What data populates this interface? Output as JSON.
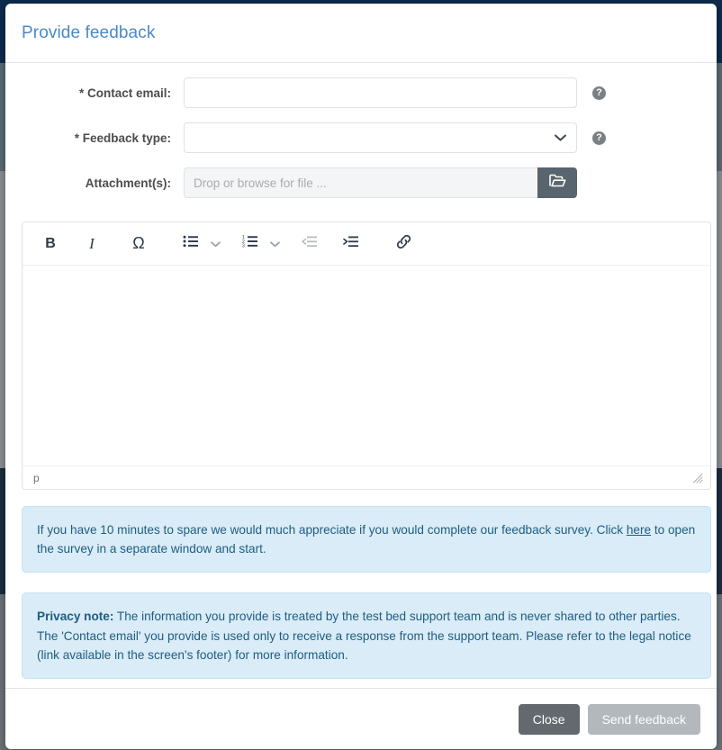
{
  "page": {
    "backdrop_color": "#0e2a47"
  },
  "modal": {
    "title": "Provide feedback",
    "accent_color": "#4a89c8"
  },
  "form": {
    "fields": [
      {
        "label": "* Contact email:",
        "type": "text",
        "value": "",
        "placeholder": "",
        "help_icon": "help-circle-icon",
        "has_help": true
      },
      {
        "label": "* Feedback type:",
        "type": "select",
        "value": "",
        "placeholder": "",
        "help_icon": "help-circle-icon",
        "has_help": true,
        "chevron_icon": "chevron-down-icon"
      },
      {
        "label": "Attachment(s):",
        "type": "file",
        "value": "",
        "placeholder": "Drop or browse for file ...",
        "browse_icon": "folder-open-icon",
        "has_help": false
      }
    ],
    "help_glyph": "?"
  },
  "editor": {
    "toolbar": [
      {
        "name": "bold",
        "label": "B",
        "icon": "bold-icon",
        "disabled": false
      },
      {
        "name": "italic",
        "label": "I",
        "icon": "italic-icon",
        "disabled": false
      },
      {
        "name": "special-character",
        "label": "Ω",
        "icon": "omega-icon",
        "disabled": false
      },
      {
        "name": "bulleted-list",
        "label": "",
        "icon": "bulleted-list-icon",
        "disabled": false
      },
      {
        "name": "bulleted-list-options",
        "label": "",
        "icon": "chevron-down-icon",
        "disabled": false
      },
      {
        "name": "numbered-list",
        "label": "",
        "icon": "numbered-list-icon",
        "disabled": false
      },
      {
        "name": "numbered-list-options",
        "label": "",
        "icon": "chevron-down-icon",
        "disabled": false
      },
      {
        "name": "decrease-indent",
        "label": "",
        "icon": "outdent-icon",
        "disabled": true
      },
      {
        "name": "increase-indent",
        "label": "",
        "icon": "indent-icon",
        "disabled": false
      },
      {
        "name": "insert-link",
        "label": "",
        "icon": "link-icon",
        "disabled": false
      }
    ],
    "content": "",
    "status_path": "p",
    "resize_icon": "resize-grip-icon"
  },
  "notices": {
    "survey": {
      "text_before": "If you have 10 minutes to spare we would much appreciate if you would complete our feedback survey. Click ",
      "link_text": "here",
      "text_after": " to open the survey in a separate window and start."
    },
    "privacy": {
      "heading": "Privacy note:",
      "text": " The information you provide is treated by the test bed support team and is never shared to other parties. The 'Contact email' you provide is used only to receive a response from the support team. Please refer to the legal notice (link available in the screen's footer) for more information."
    }
  },
  "footer": {
    "close_label": "Close",
    "send_label": "Send feedback",
    "send_disabled": true
  }
}
